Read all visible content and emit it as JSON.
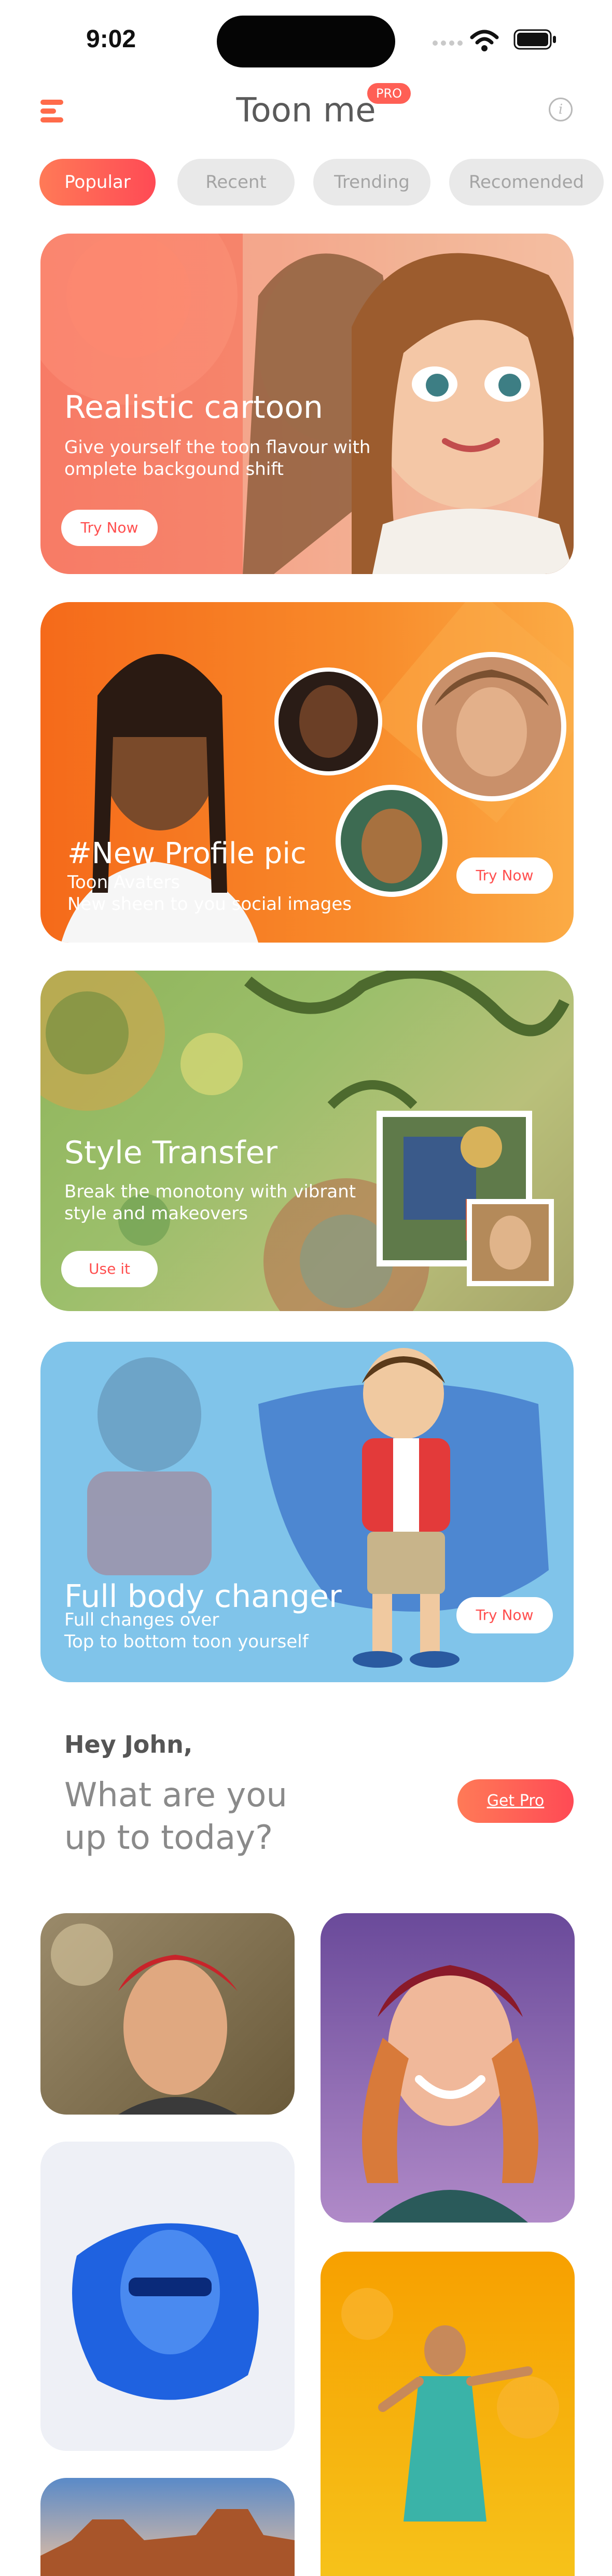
{
  "status": {
    "time": "9:02"
  },
  "header": {
    "title": "Toon me",
    "pro_badge": "PRO",
    "info_icon": "i"
  },
  "tabs": [
    {
      "label": "Popular",
      "active": true
    },
    {
      "label": "Recent",
      "active": false
    },
    {
      "label": "Trending",
      "active": false
    },
    {
      "label": "Recomended",
      "active": false
    }
  ],
  "cards": [
    {
      "title": "Realistic cartoon",
      "subtitle_line1": "Give yourself the toon flavour with",
      "subtitle_line2": "omplete backgound shift",
      "button": "Try Now"
    },
    {
      "title": "#New Profile pic",
      "subtitle_line1": "Toon Avaters",
      "subtitle_line2": "New sheen to you social images",
      "button": "Try Now"
    },
    {
      "title": "Style Transfer",
      "subtitle_line1": "Break the monotony with vibrant",
      "subtitle_line2": "style and makeovers",
      "button": "Use it"
    },
    {
      "title": "Full body changer",
      "subtitle_line1": "Full changes over",
      "subtitle_line2": "Top to bottom toon yourself",
      "button": "Try Now"
    }
  ],
  "greeting": {
    "hello": "Hey John,",
    "question_line1": "What are you",
    "question_line2": "up to today?",
    "cta": "Get Pro"
  },
  "colors": {
    "accent": "#ff5a4f",
    "accent_start": "#ff7a57",
    "tab_inactive_bg": "#e9e9e9"
  },
  "icons": [
    "menu-icon",
    "info-icon",
    "signal-icon",
    "wifi-icon",
    "battery-icon"
  ]
}
